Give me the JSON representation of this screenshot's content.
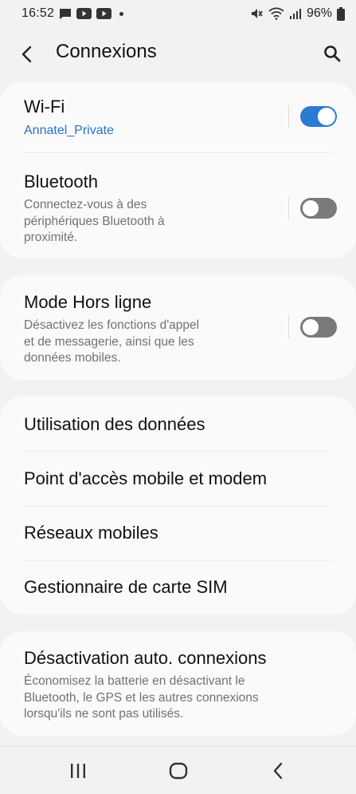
{
  "status_bar": {
    "time": "16:52",
    "battery": "96%",
    "left_icons": [
      "chat-icon",
      "youtube-icon",
      "youtube-icon",
      "dot"
    ],
    "right_icons": [
      "mute-icon",
      "wifi-icon",
      "signal-icon",
      "battery-icon"
    ]
  },
  "header": {
    "title": "Connexions",
    "back_icon": "chevron-left-icon",
    "search_icon": "search-icon"
  },
  "colors": {
    "accent": "#2a7bd3",
    "link": "#2873c8",
    "background": "#f2f2f2",
    "card": "#fafafa",
    "secondary_text": "#727272"
  },
  "card1": {
    "wifi": {
      "title": "Wi-Fi",
      "subtitle": "Annatel_Private",
      "toggle": "on"
    },
    "bluetooth": {
      "title": "Bluetooth",
      "subtitle_lines": [
        "Connectez-vous à des",
        "périphériques Bluetooth à",
        "proximité."
      ],
      "toggle": "off"
    }
  },
  "card2": {
    "airplane": {
      "title": "Mode Hors ligne",
      "subtitle_lines": [
        "Désactivez les fonctions d'appel",
        "et de messagerie, ainsi que les",
        "données mobiles."
      ],
      "toggle": "off"
    }
  },
  "card3": {
    "items": [
      "Utilisation des données",
      "Point d'accès mobile et modem",
      "Réseaux mobiles",
      "Gestionnaire de carte SIM"
    ]
  },
  "card4": {
    "title": "Désactivation auto. connexions",
    "subtitle_lines": [
      "Économisez la batterie en désactivant le",
      "Bluetooth, le GPS et les autres connexions",
      "lorsqu'ils ne sont pas utilisés."
    ]
  },
  "nav_bar": {
    "recents_icon": "recent-apps-icon",
    "home_icon": "home-icon",
    "back_icon": "back-icon"
  }
}
